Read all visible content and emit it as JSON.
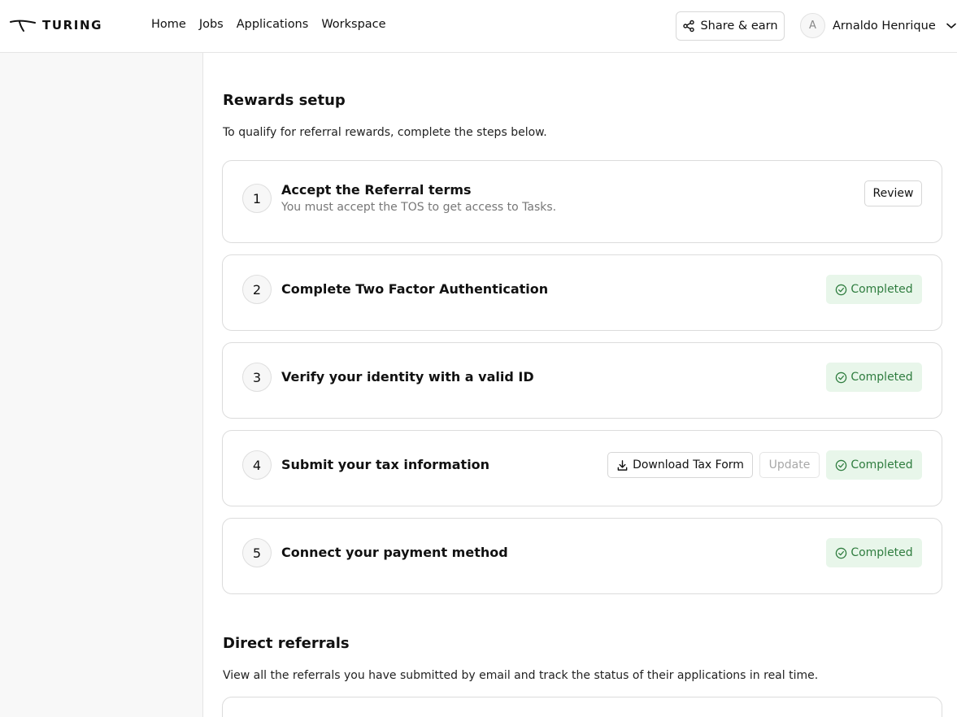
{
  "header": {
    "logo_text": "TURING",
    "nav": [
      "Home",
      "Jobs",
      "Applications",
      "Workspace"
    ],
    "share_label": "Share & earn",
    "user_initial": "A",
    "user_name": "Arnaldo Henrique"
  },
  "rewards": {
    "title": "Rewards setup",
    "description": "To qualify for referral rewards, complete the steps below.",
    "steps": [
      {
        "number": "1",
        "title": "Accept the Referral terms",
        "subtitle": "You must accept the TOS to get access to Tasks.",
        "action": "Review"
      },
      {
        "number": "2",
        "title": "Complete Two Factor Authentication",
        "status": "Completed"
      },
      {
        "number": "3",
        "title": "Verify your identity with a valid ID",
        "status": "Completed"
      },
      {
        "number": "4",
        "title": "Submit your tax information",
        "download_label": "Download Tax Form",
        "update_label": "Update",
        "status": "Completed"
      },
      {
        "number": "5",
        "title": "Connect your payment method",
        "status": "Completed"
      }
    ]
  },
  "referrals": {
    "title": "Direct referrals",
    "description": "View all the referrals you have submitted by email and track the status of their applications in real time."
  },
  "colors": {
    "completed_bg": "#e8f6ea",
    "completed_text": "#2f7d3f"
  }
}
